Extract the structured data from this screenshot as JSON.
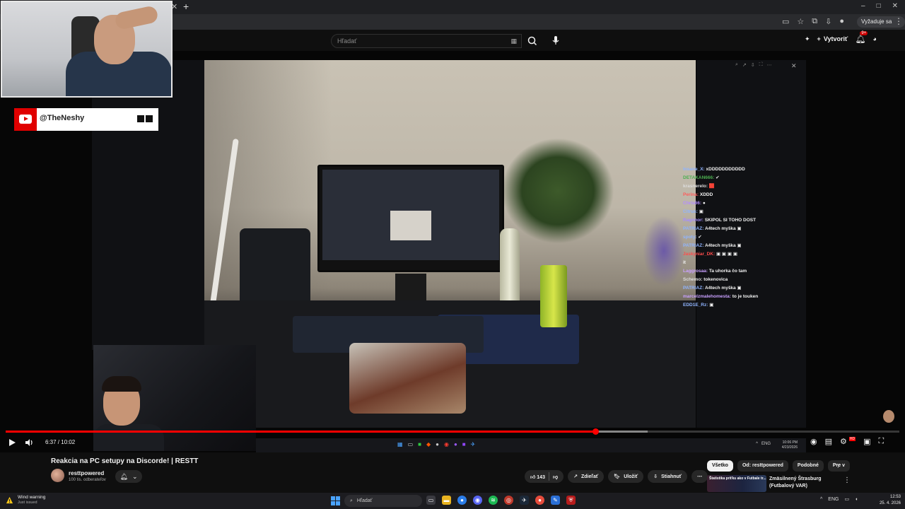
{
  "browser": {
    "window_controls": [
      "–",
      "□",
      "✕"
    ],
    "account_pill": "Vyžaduje sa akcia",
    "menu": "⋮"
  },
  "header": {
    "search_placeholder": "Hľadať",
    "create_label": "Vytvoriť",
    "notifications_badge": "9+"
  },
  "player": {
    "streamer_handle": "@TheNeshy",
    "time_current": "6:37",
    "time_total": "10:02",
    "time_display": "6:37 / 10:02",
    "progress_fraction": 0.66,
    "buffer_fraction": 0.718,
    "inner_clock_time": "10:06 PM",
    "inner_clock_date": "4/23/2026",
    "inner_tray_lang": "ENG"
  },
  "chat": [
    {
      "user": "Insane_X:",
      "msg": "xDDDDDDDDDDD",
      "color": "#8fb4ff"
    },
    {
      "user": "DETAKAN666:",
      "msg": "✔",
      "color": "#4caf50"
    },
    {
      "user": "krasnerelo:",
      "msg": "🟥",
      "color": "#dddddd"
    },
    {
      "user": "Perina:",
      "msg": "XDDD",
      "color": "#ff5c5c"
    },
    {
      "user": "Chris66:",
      "msg": "●",
      "color": "#b38cff"
    },
    {
      "user": "Citrus:",
      "msg": "▣",
      "color": "#8fb4ff"
    },
    {
      "user": "Ragnnor:",
      "msg": "SKIPOL SI TOHO DOST",
      "color": "#a58cff"
    },
    {
      "user": "PATRIAZ:",
      "msg": "A4tech myška ▣",
      "color": "#8fb4ff"
    },
    {
      "user": "spoty:",
      "msg": "✔",
      "color": "#8fb4ff"
    },
    {
      "user": "PATRIAZ:",
      "msg": "A4tech myška ▣",
      "color": "#8fb4ff"
    },
    {
      "user": "Jaskyniar_DK:",
      "msg": "▣ ▣ ▣ ▣",
      "color": "#ff4c4c"
    },
    {
      "user": "",
      "msg": "it",
      "color": "#dddddd"
    },
    {
      "user": "Laggrosaa:",
      "msg": "Ta uhorka čo tam",
      "color": "#c9a0ff"
    },
    {
      "user": "Schemo:",
      "msg": "tokenovica",
      "color": "#dddddd"
    },
    {
      "user": "PATRIAZ:",
      "msg": "A4tech myška ▣",
      "color": "#8fb4ff"
    },
    {
      "user": "marcelzmalehomesta:",
      "msg": "to je touken",
      "color": "#c9a0ff"
    },
    {
      "user": "EDD1E_Rz:",
      "msg": "▣",
      "color": "#8fb4ff"
    }
  ],
  "video": {
    "title": "Reakcia na PC setupy na Discorde! | RESTT",
    "channel_name": "resttpowered",
    "channel_subs": "100 tis. odberateľov",
    "likes": "143",
    "share_label": "Zdieľať",
    "save_label": "Uložiť",
    "download_label": "Stiahnuť",
    "more": "⋯"
  },
  "sidebar": {
    "chips": [
      "Všetko",
      "Od: resttpowered",
      "Podobné",
      "Pre v"
    ],
    "active_chip": 0,
    "recommended_title": "Zmäsilnený Štrasburg (Futbalový VAR)",
    "recommended_thumb_text": "Štatistika príťku ako v Futbale tr..."
  },
  "taskbar": {
    "weather_title": "Wind warning",
    "weather_sub": "Just issued",
    "search_placeholder": "Hľadať",
    "lang": "ENG",
    "time": "12:53",
    "date": "25. 4. 2026"
  },
  "colors": {
    "accent_red": "#ff0000",
    "yt_red": "#e00000",
    "chip_active": "#f1f1f1",
    "background": "#0f0f0f"
  }
}
